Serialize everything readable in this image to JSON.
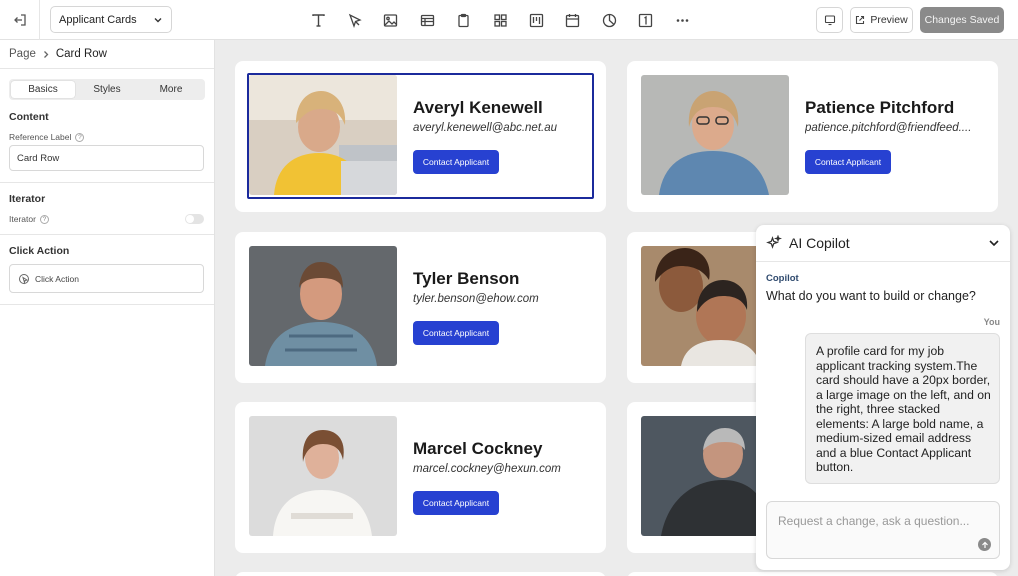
{
  "toolbar": {
    "page_select_value": "Applicant Cards",
    "preview_label": "Preview",
    "saved_label": "Changes Saved",
    "tools": [
      "text-tool-icon",
      "select-tool-icon",
      "image-tool-icon",
      "table-tool-icon",
      "clipboard-tool-icon",
      "grid-tool-icon",
      "kanban-tool-icon",
      "calendar-tool-icon",
      "chart-tool-icon",
      "number-tool-icon",
      "more-icon"
    ]
  },
  "sidebar": {
    "breadcrumb": {
      "parent": "Page",
      "current": "Card Row"
    },
    "tabs": [
      "Basics",
      "Styles",
      "More"
    ],
    "active_tab": "Basics",
    "content": {
      "title": "Content",
      "reference_label": "Reference Label",
      "reference_value": "Card Row"
    },
    "iterator": {
      "title": "Iterator",
      "label": "Iterator",
      "enabled": false
    },
    "click_action": {
      "title": "Click Action",
      "button_label": "Click Action"
    }
  },
  "cards": [
    {
      "name": "Averyl Kenewell",
      "email": "averyl.kenewell@abc.net.au",
      "cta": "Contact Applicant"
    },
    {
      "name": "Patience Pitchford",
      "email": "patience.pitchford@friendfeed....",
      "cta": "Contact Applicant"
    },
    {
      "name": "Tyler Benson",
      "email": "tyler.benson@ehow.com",
      "cta": "Contact Applicant"
    },
    {
      "name": "Marcel Cockney",
      "email": "marcel.cockney@hexun.com",
      "cta": "Contact Applicant"
    }
  ],
  "copilot": {
    "title": "AI Copilot",
    "sender": "Copilot",
    "question": "What do you want to build or change?",
    "you_label": "You",
    "user_message": "A profile card for my job applicant tracking system.The card should have a 20px border, a large image on the left, and on the right, three stacked elements: A large bold name, a medium-sized email address and a blue Contact Applicant button.",
    "input_placeholder": "Request a change, ask a question..."
  },
  "colors": {
    "accent": "#2741d1",
    "selection": "#1b2a9c",
    "saved_bg": "#8a8a8a",
    "canvas": "#ececec"
  }
}
